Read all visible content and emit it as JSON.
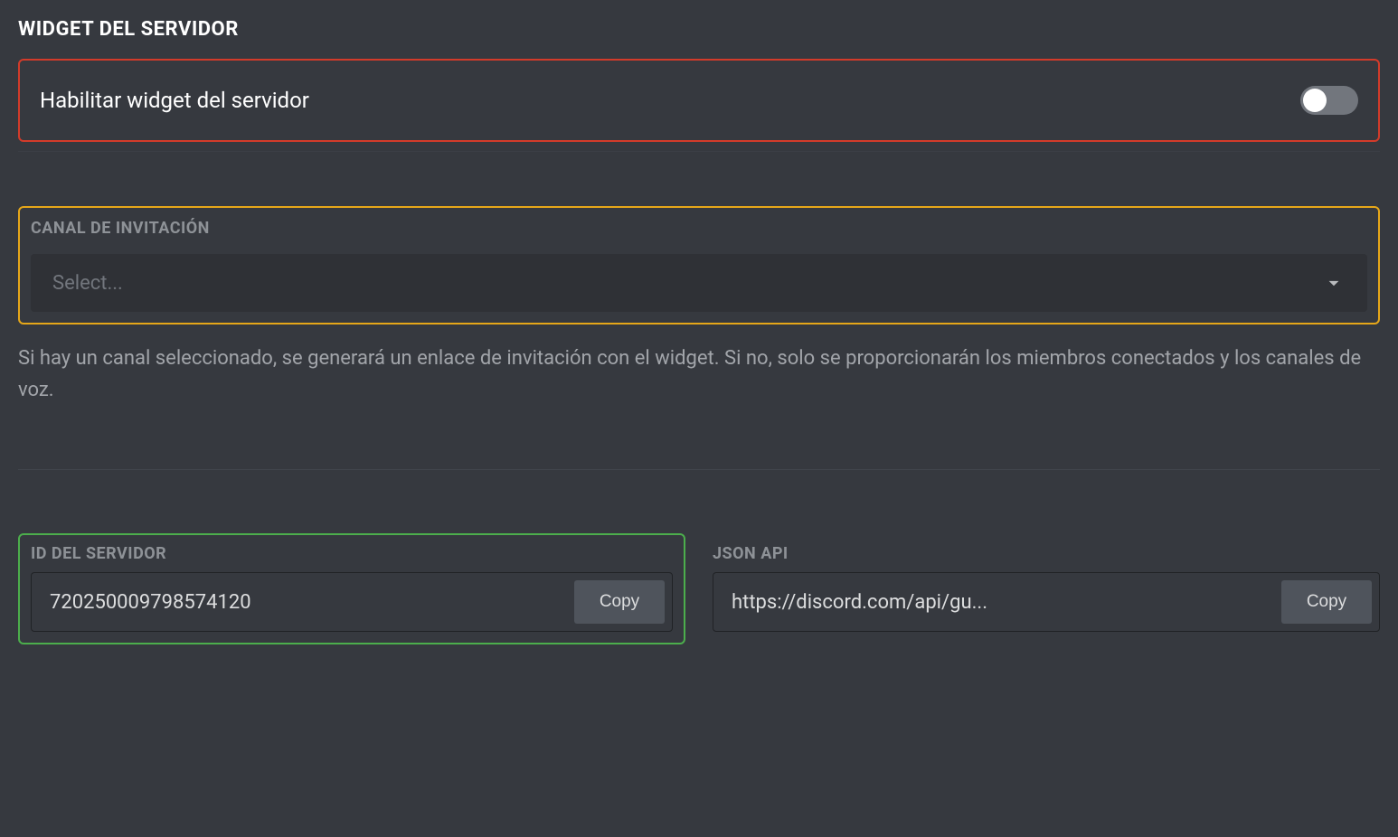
{
  "heading": "WIDGET DEL SERVIDOR",
  "enable": {
    "label": "Habilitar widget del servidor",
    "on": false
  },
  "invite": {
    "label": "CANAL DE INVITACIÓN",
    "placeholder": "Select..."
  },
  "help_text": "Si hay un canal seleccionado, se generará un enlace de invitación con el widget. Si no, solo se proporcionarán los miembros conectados y los canales de voz.",
  "server_id": {
    "label": "ID DEL SERVIDOR",
    "value": "720250009798574120",
    "copy_label": "Copy"
  },
  "json_api": {
    "label": "JSON API",
    "value": "https://discord.com/api/gu...",
    "copy_label": "Copy"
  }
}
